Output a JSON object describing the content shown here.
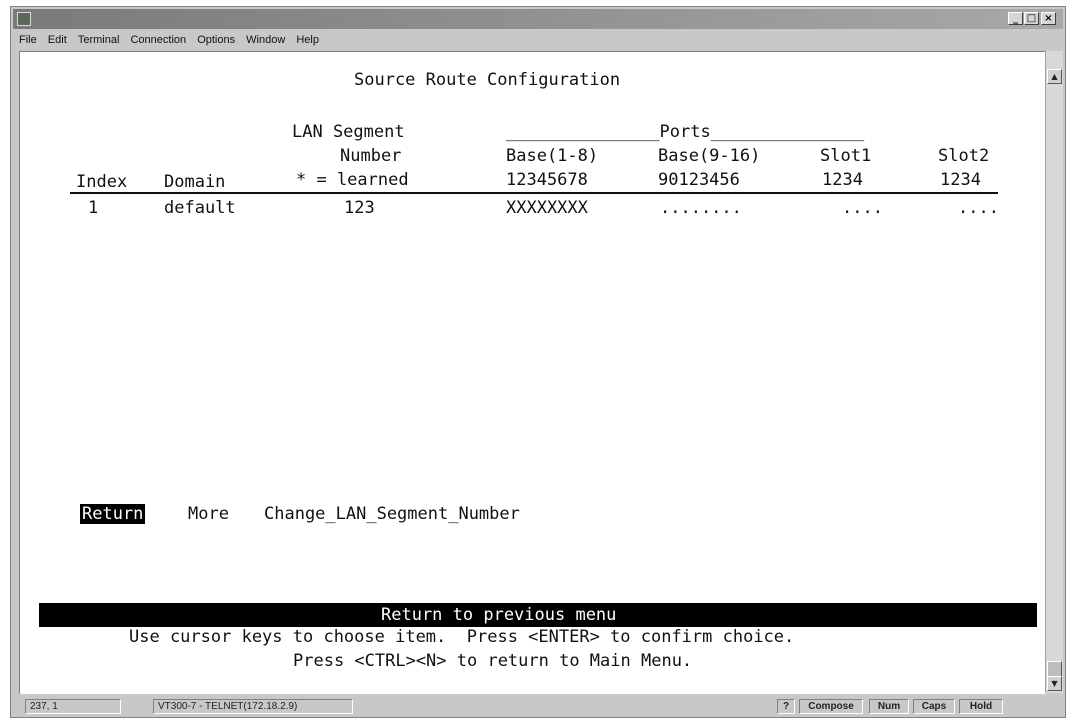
{
  "window": {
    "title": "",
    "controls": {
      "minimize": "_",
      "maximize": "□",
      "close": "×"
    }
  },
  "menubar": [
    "File",
    "Edit",
    "Terminal",
    "Connection",
    "Options",
    "Window",
    "Help"
  ],
  "screen": {
    "title": "Source Route Configuration",
    "header": {
      "lan_segment_line1": "LAN Segment",
      "lan_segment_line2": "Number",
      "lan_segment_line3": "* = learned",
      "ports_banner": "_______________Ports_______________",
      "base_1_8": "Base(1-8)",
      "base_9_16": "Base(9-16)",
      "slot1": "Slot1",
      "slot2": "Slot2",
      "index": "Index",
      "domain": "Domain",
      "base_1_8_digits": "12345678",
      "base_9_16_digits": "90123456",
      "slot1_digits": "1234",
      "slot2_digits": "1234"
    },
    "rows": [
      {
        "index": "1",
        "domain": "default",
        "lan_segment": "123",
        "base_1_8": "XXXXXXXX",
        "base_9_16": "........",
        "slot1": "....",
        "slot2": "...."
      }
    ],
    "commands": [
      "Return",
      "More",
      "Change_LAN_Segment_Number"
    ],
    "selected_command": "Return",
    "help_bar": "Return to previous menu",
    "help_line1": "Use cursor keys to choose item.  Press <ENTER> to confirm choice.",
    "help_line2": "Press <CTRL><N> to return to Main Menu."
  },
  "statusbar": {
    "cursor_pos": "237, 1",
    "connection": "VT300-7 - TELNET(172.18.2.9)",
    "help": "?",
    "compose": "Compose",
    "num": "Num",
    "caps": "Caps",
    "hold": "Hold"
  },
  "colors": {
    "terminal_bg": "#ffffff",
    "terminal_fg": "#111111",
    "highlight_bg": "#000000",
    "chrome": "#c8c8c8"
  }
}
